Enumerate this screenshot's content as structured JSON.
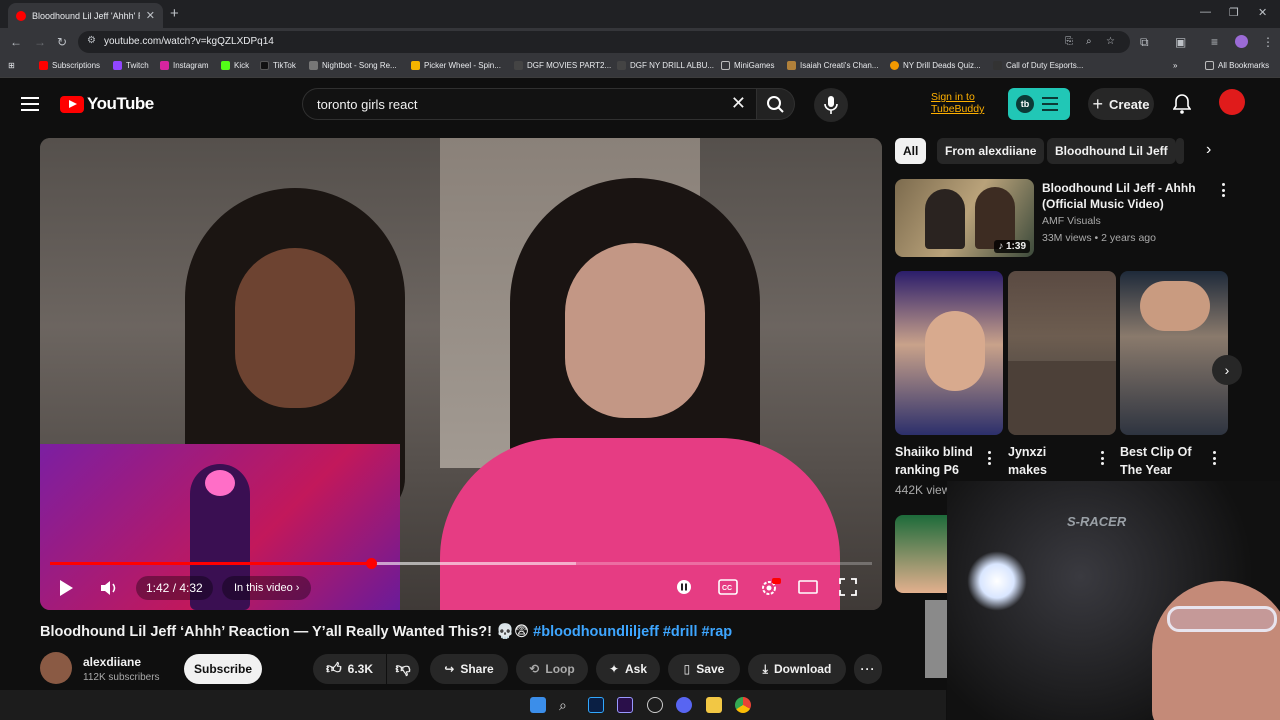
{
  "browser": {
    "tab_title": "Bloodhound Lil Jeff 'Ahhh' Reac...",
    "url": "youtube.com/watch?v=kgQZLXDPq14",
    "bookmarks": [
      "Subscriptions",
      "Twitch",
      "Instagram",
      "Kick",
      "TikTok",
      "Nightbot - Song Re...",
      "Picker Wheel - Spin...",
      "DGF MOVIES PART2...",
      "DGF NY DRILL ALBU...",
      "MiniGames",
      "Isaiah Creati's Chan...",
      "NY Drill Deads Quiz...",
      "Call of Duty Esports..."
    ],
    "all_bookmarks": "All Bookmarks"
  },
  "youtube": {
    "logo_text": "YouTube",
    "search_query": "toronto girls react",
    "tubebuddy_line1": "Sign in to",
    "tubebuddy_line2": "TubeBuddy",
    "create_label": "Create"
  },
  "player": {
    "time": "1:42 / 4:32",
    "chapter_label": "In this video",
    "progress_fraction": 0.39,
    "buffered_fraction": 0.64
  },
  "video": {
    "title_main": "Bloodhound Lil Jeff ‘Ahhh’ Reaction — Y’all Really Wanted This?! 💀😨 ",
    "title_tags": "#bloodhoundliljeff #drill #rap",
    "channel_name": "alexdiiane",
    "subscriber_count": "112K subscribers",
    "subscribe_label": "Subscribe",
    "like_count": "6.3K",
    "share_label": "Share",
    "loop_label": "Loop",
    "ask_label": "Ask",
    "save_label": "Save",
    "download_label": "Download"
  },
  "sidebar": {
    "chips": [
      "All",
      "From alexdiiane",
      "Bloodhound Lil Jeff"
    ],
    "rec": {
      "title": "Bloodhound Lil Jeff - Ahhh (Official Music Video)",
      "channel": "AMF Visuals",
      "meta": "33M views • 2 years ago",
      "duration": "1:39"
    },
    "shorts": [
      {
        "title": "Shaiiko blind ranking P6"
      },
      {
        "title": "Jynxzi makes"
      },
      {
        "title": "Best Clip Of The Year"
      }
    ],
    "short_views": "442K view",
    "webcam_overlay_text": "S-RACER"
  },
  "colors": {
    "accent": "#ff0000",
    "link": "#3ea6ff",
    "tubebuddy": "#21c7b6",
    "background": "#0f0f0f"
  }
}
